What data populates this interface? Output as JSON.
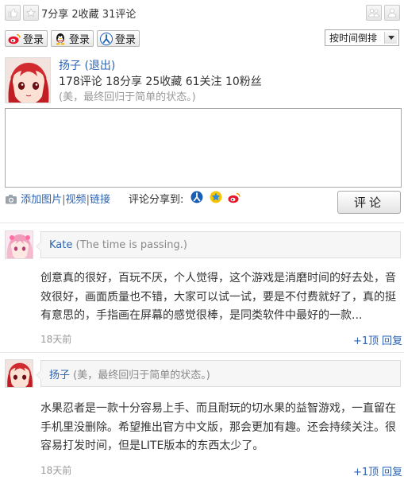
{
  "top": {
    "stats": "7分享 2收藏 31评论",
    "icons": [
      "thumbs-up-icon",
      "star-icon",
      "users-icon",
      "user-icon"
    ]
  },
  "login": {
    "weibo_label": "登录",
    "qq_label": "登录",
    "renren_label": "登录",
    "sort_label": "按时间倒排"
  },
  "profile": {
    "name": "扬子",
    "logout": "(退出)",
    "stats": "178评论 18分享 25收藏 61关注 10粉丝",
    "status": "(美，最终回归于简单的状态。)"
  },
  "composer": {
    "add_image": "添加图片",
    "video": "视频",
    "link": "链接",
    "share_to": "评论分享到:",
    "submit": "评论",
    "sep": "|"
  },
  "comments": [
    {
      "name": "Kate",
      "status": "(The time is passing.)",
      "text": "创意真的很好，百玩不厌，个人觉得，这个游戏是消磨时间的好去处，音效很好，画面质量也不错，大家可以试一试，要是不付费就好了，真的挺有意思的，手指画在屏幕的感觉很棒，是同类软件中最好的一款...",
      "time": "18天前",
      "plus": "+1顶",
      "reply": "回复"
    },
    {
      "name": "扬子",
      "status": "(美，最终回归于简单的状态。)",
      "text": "水果忍者是一款十分容易上手、而且耐玩的切水果的益智游戏，一直留在手机里没删除。希望推出官方中文版，那会更加有趣。还会持续关注。很容易打发时间，但是LITE版本的东西太少了。",
      "time": "18天前",
      "plus": "+1顶",
      "reply": "回复"
    }
  ],
  "colors": {
    "link": "#2d64b3",
    "muted": "#999999"
  }
}
